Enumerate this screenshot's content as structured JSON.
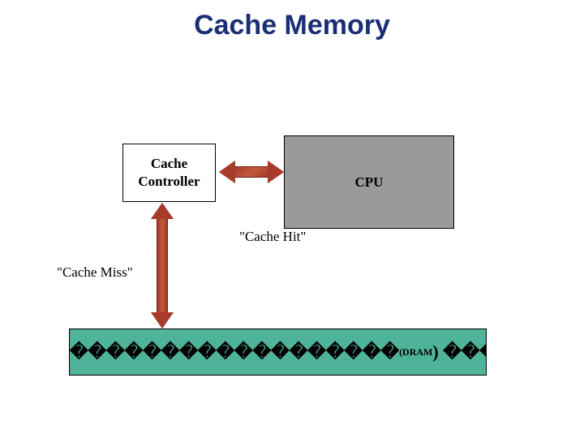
{
  "title": "Cache Memory",
  "nodes": {
    "cache_controller_line1": "Cache",
    "cache_controller_line2": "Controller",
    "cpu": "CPU",
    "dram_prefix": "������������������",
    "dram_mid": "(DRAM",
    "dram_suffix": ") ����"
  },
  "labels": {
    "hit": "\"Cache Hit\"",
    "miss": "\"Cache Miss\""
  }
}
